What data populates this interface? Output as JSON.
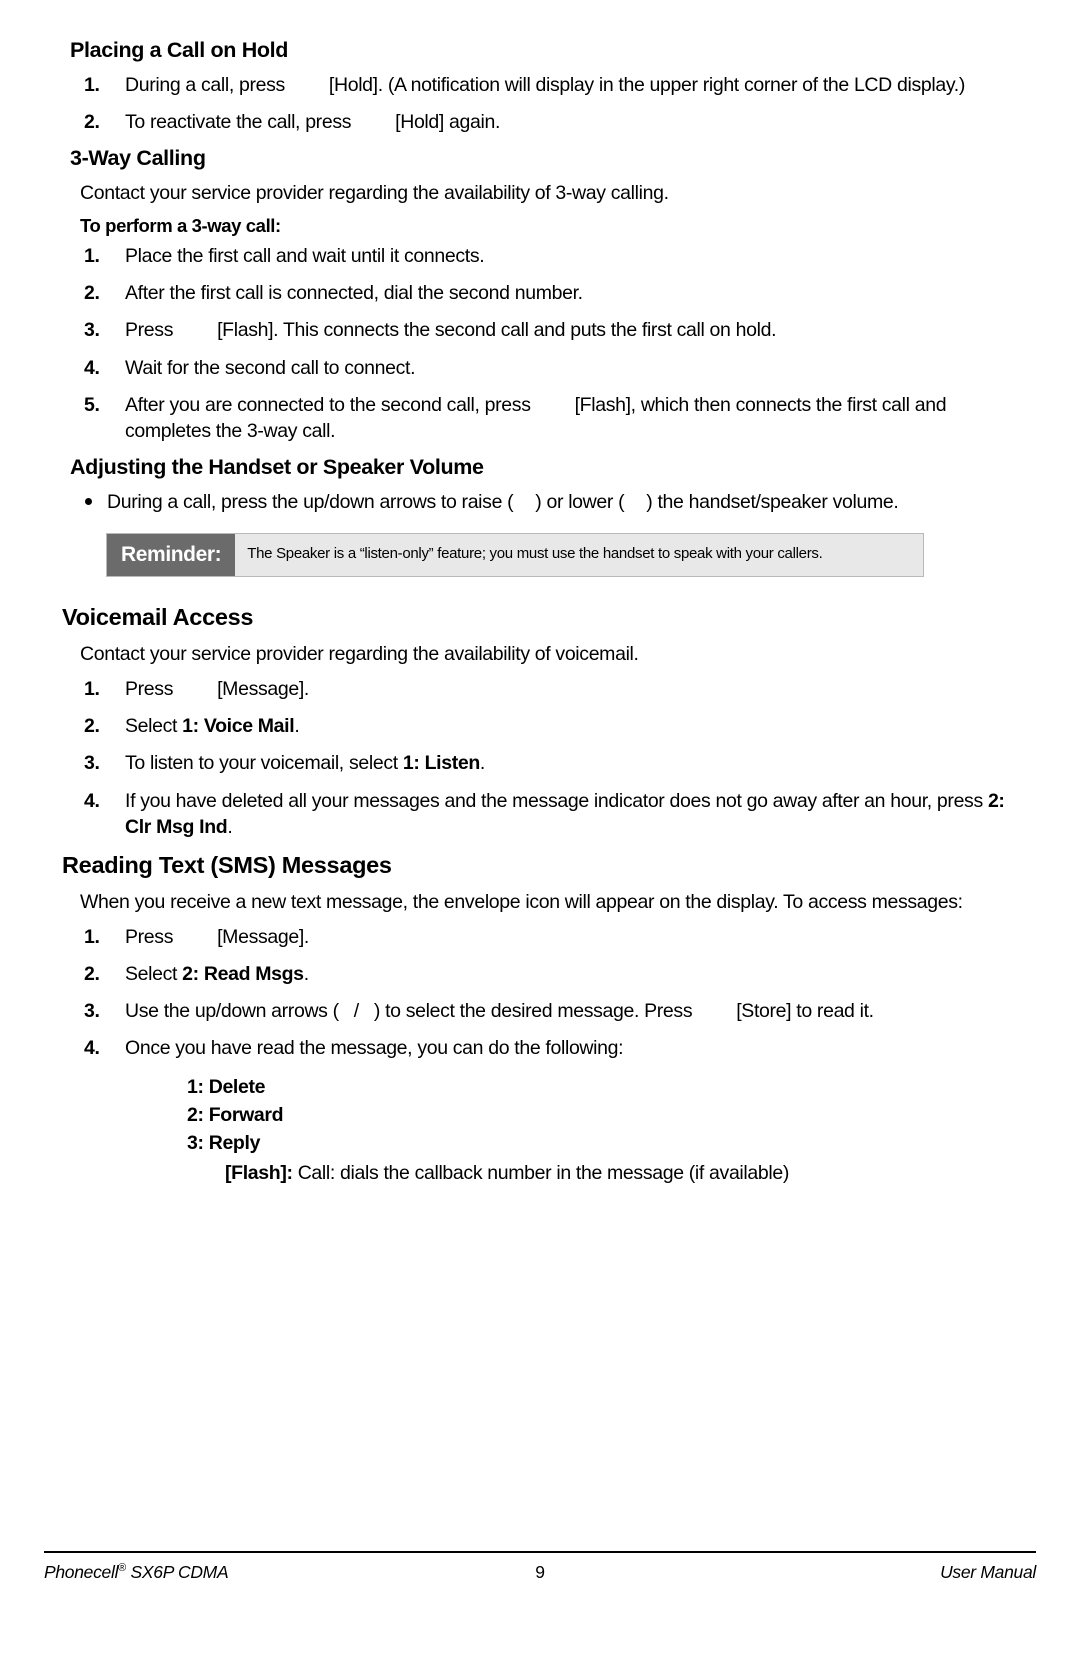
{
  "document": {
    "sections": [
      {
        "id": "placing-call-on-hold",
        "heading": "Placing a Call on Hold",
        "steps": [
          {
            "num": "1.",
            "pre": "During a call, press",
            "post": "[Hold]. (A notification will display in the upper right corner of the LCD display.)"
          },
          {
            "num": "2.",
            "pre": "To reactivate the call, press",
            "post": "[Hold] again."
          }
        ]
      },
      {
        "id": "three-way-calling",
        "heading": "3-Way Calling",
        "intro": "Contact your service provider regarding the availability of 3-way calling.",
        "subheading": "To perform a 3-way call:",
        "steps": [
          {
            "num": "1.",
            "pre": "Place the first call and wait until it connects.",
            "post": ""
          },
          {
            "num": "2.",
            "pre": "After the first call is connected, dial the second number.",
            "post": ""
          },
          {
            "num": "3.",
            "pre": "Press",
            "post": "[Flash]. This connects the second call and puts the first call on hold."
          },
          {
            "num": "4.",
            "pre": "Wait for the second call to connect.",
            "post": ""
          },
          {
            "num": "5.",
            "pre": "After you are connected to the second call, press",
            "post": "[Flash], which then connects the first call and completes the 3-way call."
          }
        ]
      },
      {
        "id": "adjusting-volume",
        "heading": "Adjusting the Handset or Speaker Volume",
        "bullet_pre": "During a call, press the up/down arrows to raise (",
        "bullet_mid": ") or lower (",
        "bullet_post": ") the handset/speaker volume."
      }
    ],
    "reminder": {
      "label": "Reminder:",
      "text": "The Speaker is a “listen-only” feature; you must use the handset to speak with your callers."
    },
    "voicemail": {
      "heading": "Voicemail Access",
      "intro": "Contact your service provider regarding the availability of voicemail.",
      "steps": [
        {
          "num": "1.",
          "pre": "Press",
          "post": "[Message]."
        },
        {
          "num": "2.",
          "pre": "Select ",
          "bold": "1: Voice Mail",
          "post": "."
        },
        {
          "num": "3.",
          "pre": "To listen to your voicemail, select ",
          "bold": "1: Listen",
          "post": "."
        },
        {
          "num": "4.",
          "pre": "If you have deleted all your messages and the message indicator does not go away after an hour, press ",
          "bold": "2: Clr Msg Ind",
          "post": "."
        }
      ]
    },
    "sms": {
      "heading": "Reading Text (SMS) Messages",
      "intro": "When you receive a new text message, the envelope icon will appear on the display. To access messages:",
      "steps": [
        {
          "num": "1.",
          "pre": "Press",
          "post": "[Message]."
        },
        {
          "num": "2.",
          "pre": "Select ",
          "bold": "2: Read Msgs",
          "post": "."
        },
        {
          "num": "3.",
          "pre": "Use the up/down arrows (",
          "mid": "/",
          "post2": ") to select the desired message. Press",
          "post3": "[Store] to read it."
        },
        {
          "num": "4.",
          "pre": "Once you have read the message, you can do the following:",
          "post": ""
        }
      ],
      "options": [
        "1: Delete",
        "2: Forward",
        "3: Reply"
      ],
      "flash_label": "[Flash]:",
      "flash_text": " Call: dials the callback number in the message (if available)"
    },
    "footer": {
      "left": "Phonecell",
      "left_sup": "®",
      "left_rest": " SX6P CDMA",
      "page_number": "9",
      "right": "User Manual"
    },
    "colors": {
      "reminder_label_bg": "#6b6b6b",
      "reminder_body_bg": "#e8e8e8",
      "text": "#000000",
      "page_bg": "#ffffff"
    }
  }
}
